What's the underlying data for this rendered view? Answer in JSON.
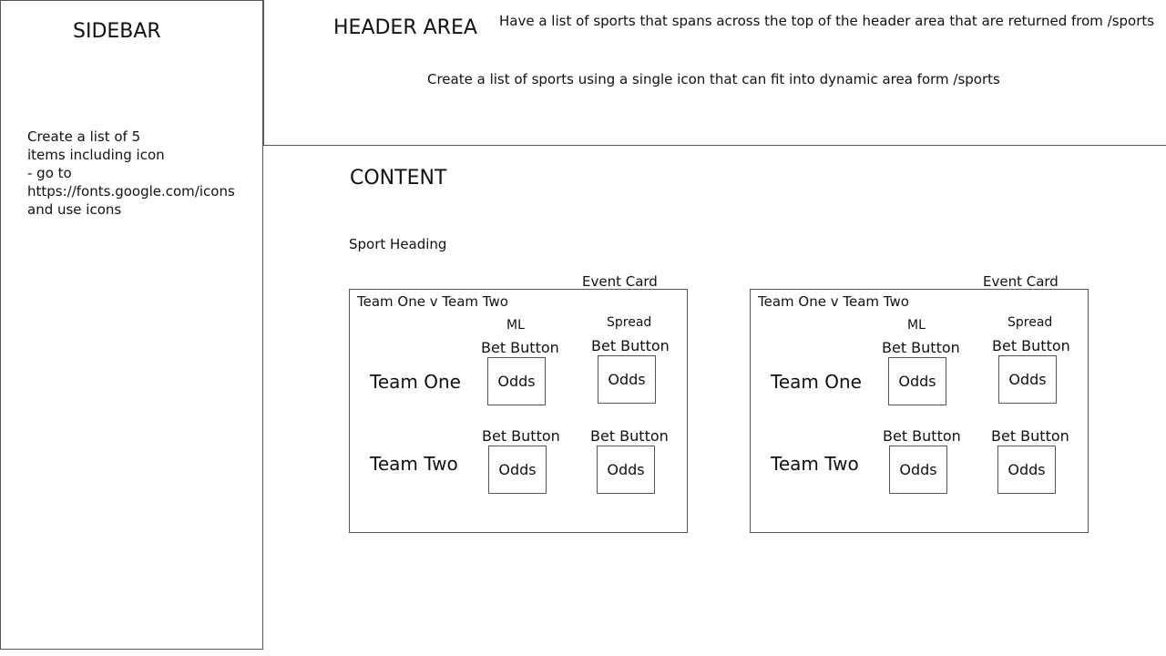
{
  "sidebar": {
    "title": "SIDEBAR",
    "note": "Create a list of 5\nitems including icon\n- go to\nhttps://fonts.google.com/icons\nand use icons"
  },
  "header": {
    "title": "HEADER AREA",
    "note_top": "Have a list of sports that spans across the top of the header area that are returned from /sports",
    "note_bottom": "Create a list of sports using a single icon that can fit into dynamic area form /sports"
  },
  "content": {
    "title": "CONTENT",
    "sport_heading": "Sport Heading"
  },
  "event_cards": [
    {
      "label": "Event Card",
      "matchup": "Team One v Team Two",
      "ml_label": "ML",
      "spread_label": "Spread",
      "team_one": "Team One",
      "team_two": "Team Two",
      "bet_button_label": "Bet Button",
      "odds_label": "Odds"
    },
    {
      "label": "Event Card",
      "matchup": "Team One v Team Two",
      "ml_label": "ML",
      "spread_label": "Spread",
      "team_one": "Team One",
      "team_two": "Team Two",
      "bet_button_label": "Bet Button",
      "odds_label": "Odds"
    }
  ]
}
